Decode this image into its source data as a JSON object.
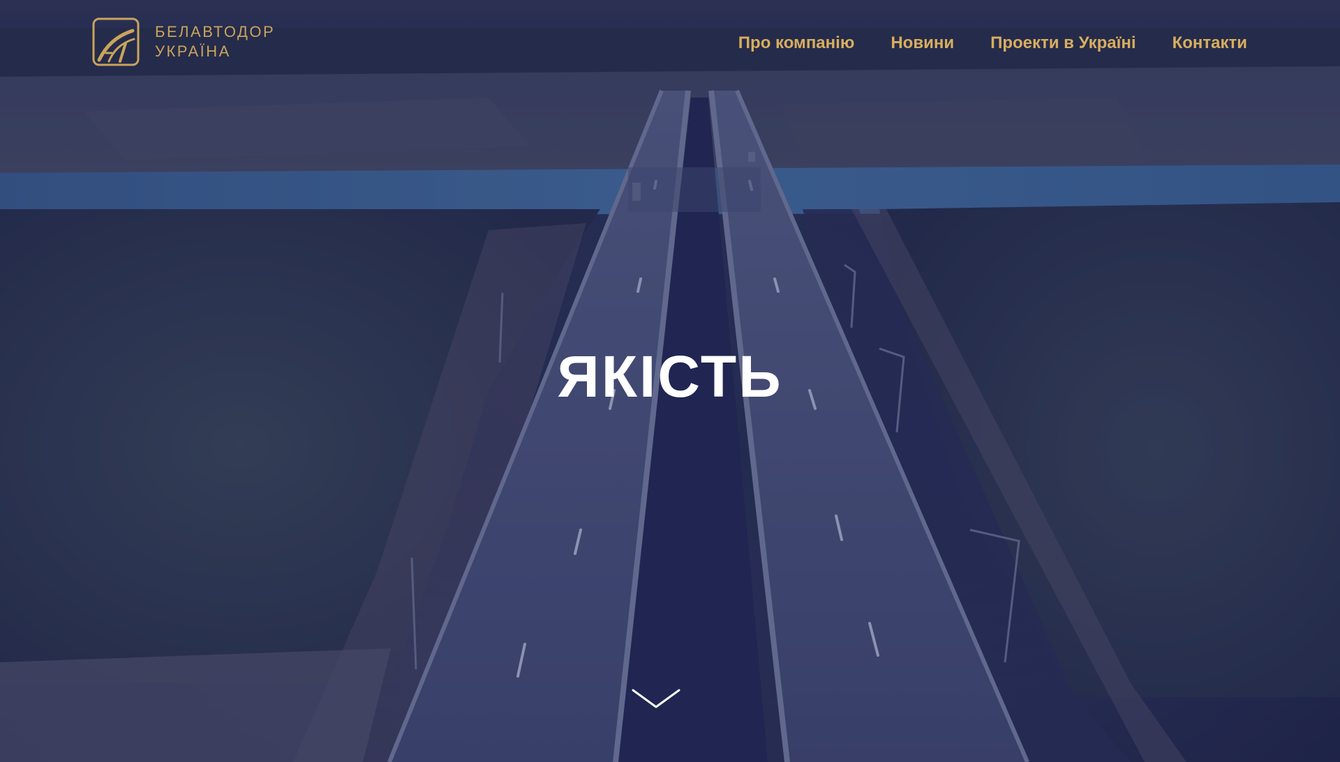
{
  "brand": {
    "line1": "БЕЛАВТОДОР",
    "line2": "УКРАЇНА",
    "logo_icon": "road-logo-icon",
    "color": "#c9a45c"
  },
  "nav": {
    "items": [
      {
        "label": "Про компанію"
      },
      {
        "label": "Новини"
      },
      {
        "label": "Проекти в Україні"
      },
      {
        "label": "Контакти"
      }
    ],
    "color": "#d8ae5e"
  },
  "hero": {
    "headline": "ЯКІСТЬ",
    "scroll_icon": "chevron-down-icon"
  }
}
